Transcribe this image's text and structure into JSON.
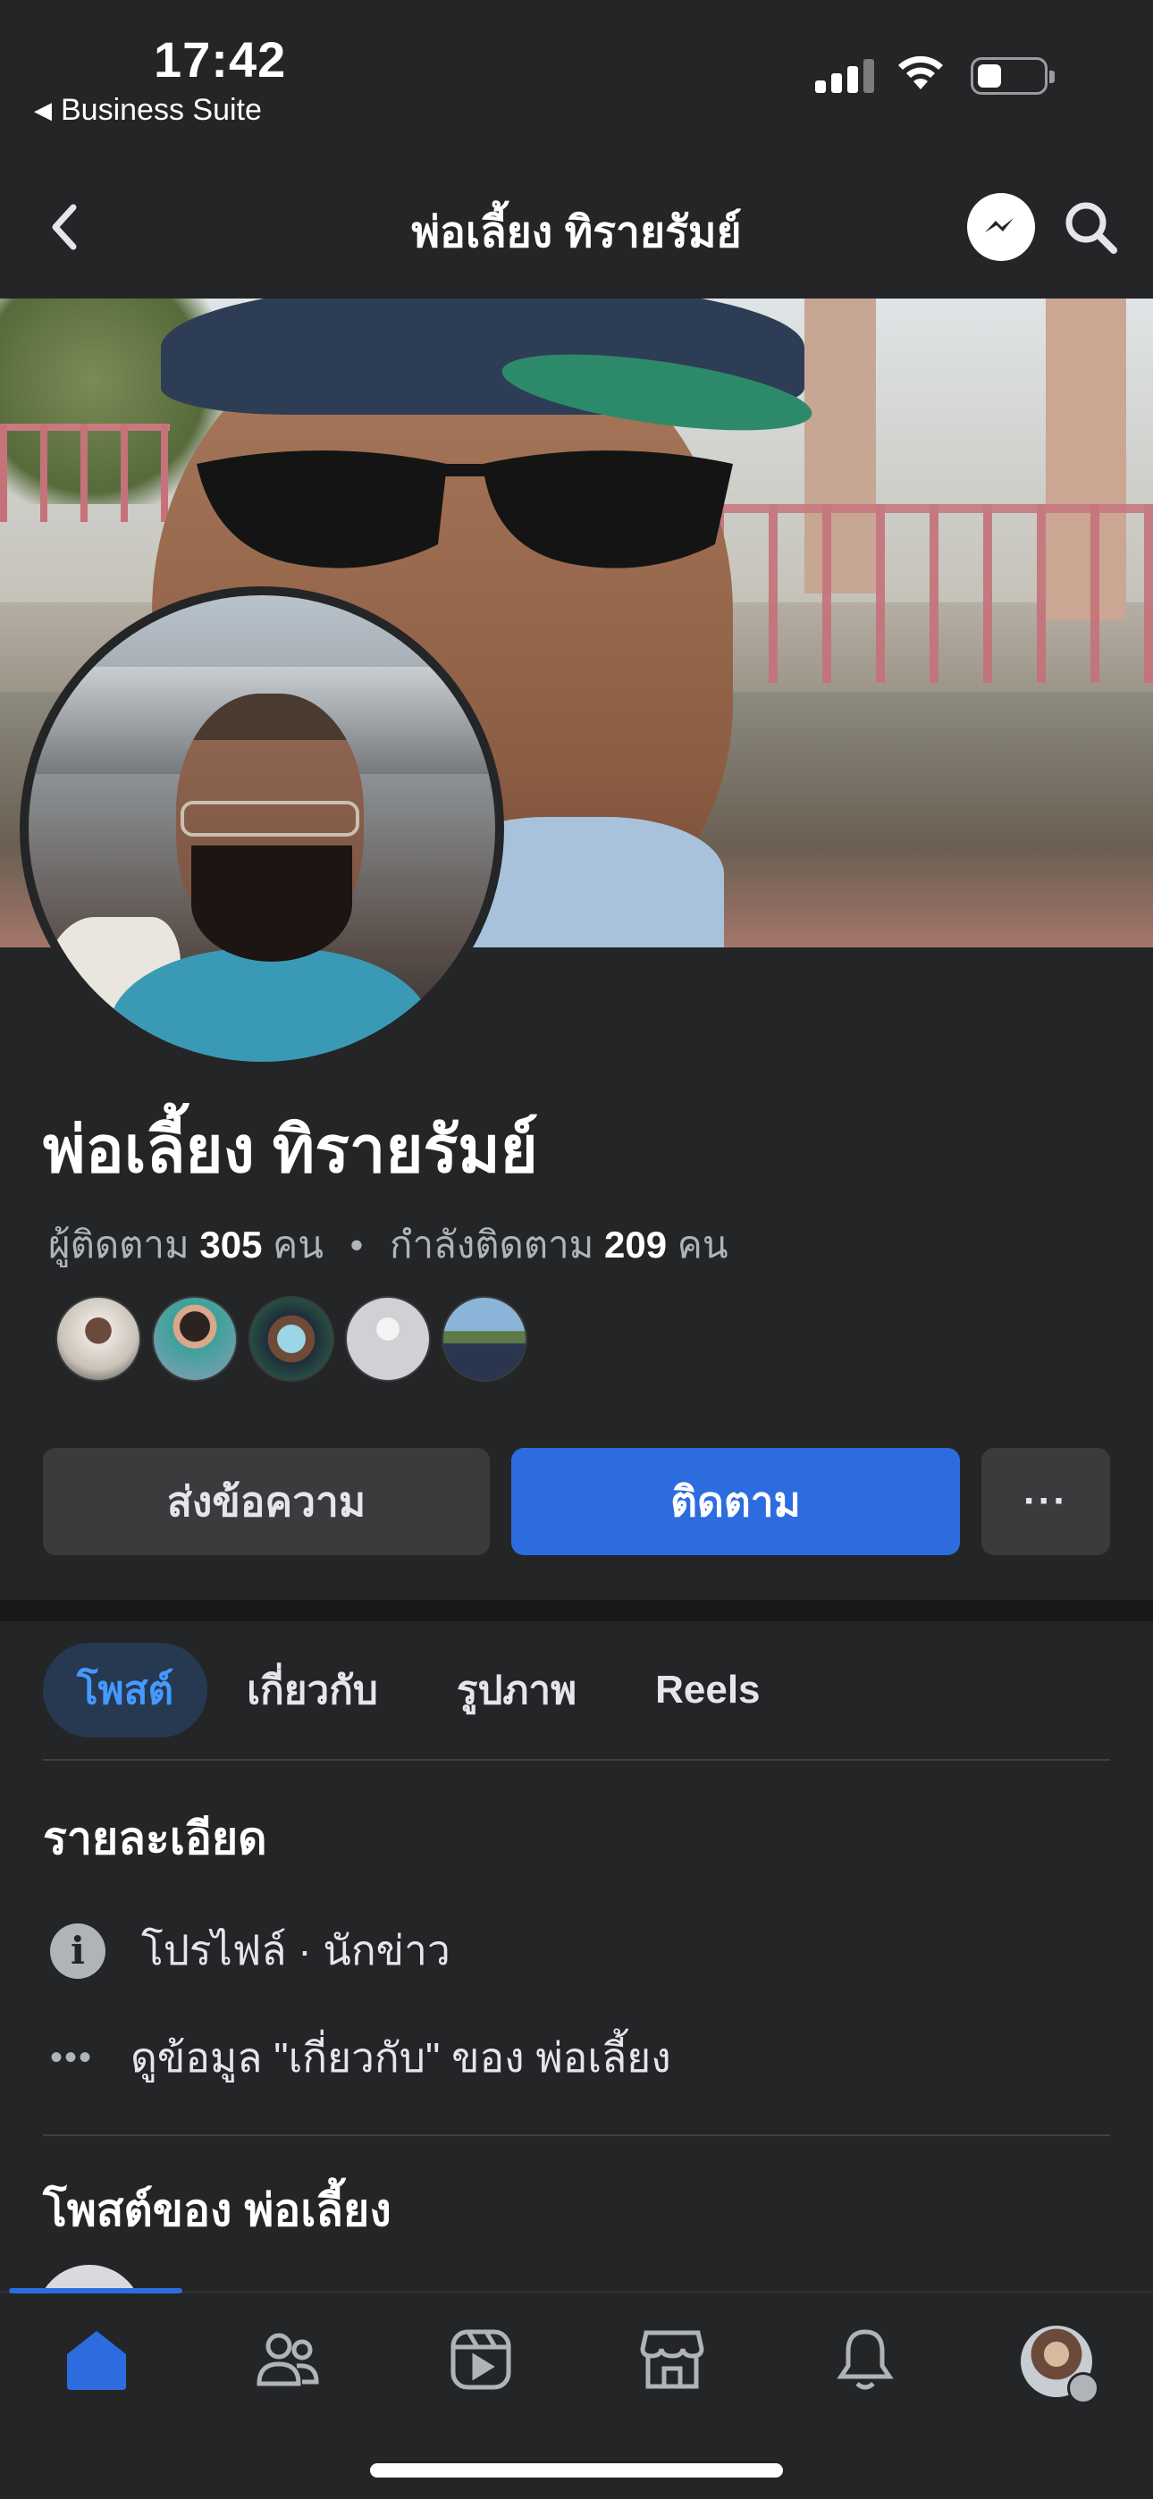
{
  "status_bar": {
    "time": "17:42",
    "back_app": "Business Suite",
    "back_icon": "triangle-left-icon"
  },
  "header": {
    "title": "พ่อเลี้ยง ทิรายรัมย์",
    "back_icon": "chevron-left-icon",
    "messenger_icon": "messenger-icon",
    "search_icon": "search-icon"
  },
  "profile": {
    "name": "พ่อเลี้ยง ทิรายรัมย์",
    "followers_label": "ผู้ติดตาม",
    "followers_count": "305",
    "followers_unit": "คน",
    "separator": "•",
    "following_label": "กำลังติดตาม",
    "following_count": "209",
    "following_unit": "คน"
  },
  "actions": {
    "message_label": "ส่งข้อความ",
    "follow_label": "ติดตาม",
    "more_label": "···"
  },
  "tabs": [
    {
      "label": "โพสต์",
      "active": true
    },
    {
      "label": "เกี่ยวกับ",
      "active": false
    },
    {
      "label": "รูปภาพ",
      "active": false
    },
    {
      "label": "Reels",
      "active": false
    }
  ],
  "details": {
    "heading": "รายละเอียด",
    "profile_type": "โปรไฟล์ · นักข่าว",
    "see_about": "ดูข้อมูล \"เกี่ยวกับ\" ของ พ่อเลี้ยง"
  },
  "posts": {
    "heading": "โพสต์ของ พ่อเลี้ยง"
  },
  "colors": {
    "background": "#242526",
    "accent": "#2d6cdf",
    "active_tab_bg": "#263951",
    "active_tab_text": "#4599ff"
  },
  "bottom_nav": [
    {
      "icon": "home-icon",
      "active": true
    },
    {
      "icon": "friends-icon",
      "active": false
    },
    {
      "icon": "video-icon",
      "active": false
    },
    {
      "icon": "marketplace-icon",
      "active": false
    },
    {
      "icon": "bell-icon",
      "active": false
    },
    {
      "icon": "profile-menu-avatar",
      "active": false
    }
  ]
}
